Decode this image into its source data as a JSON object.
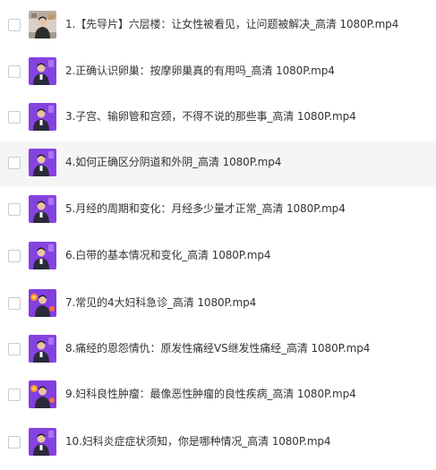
{
  "files": [
    {
      "name": "1.【先导片】六层楼：让女性被看见，让问题被解决_高清 1080P.mp4",
      "thumb": "room"
    },
    {
      "name": "2.正确认识卵巢：按摩卵巢真的有用吗_高清 1080P.mp4",
      "thumb": "purple"
    },
    {
      "name": "3.子宫、输卵管和宫颈，不得不说的那些事_高清 1080P.mp4",
      "thumb": "purple"
    },
    {
      "name": "4.如何正确区分阴道和外阴_高清 1080P.mp4",
      "thumb": "purple"
    },
    {
      "name": "5.月经的周期和变化：月经多少量才正常_高清 1080P.mp4",
      "thumb": "purple"
    },
    {
      "name": "6.白带的基本情况和变化_高清 1080P.mp4",
      "thumb": "purple"
    },
    {
      "name": "7.常见的4大妇科急诊_高清 1080P.mp4",
      "thumb": "emoji"
    },
    {
      "name": "8.痛经的恩怨情仇：原发性痛经VS继发性痛经_高清 1080P.mp4",
      "thumb": "purple"
    },
    {
      "name": "9.妇科良性肿瘤：最像恶性肿瘤的良性疾病_高清 1080P.mp4",
      "thumb": "emoji"
    },
    {
      "name": "10.妇科炎症症状须知，你是哪种情况_高清 1080P.mp4",
      "thumb": "purple"
    }
  ],
  "hovered_index": 3,
  "colors": {
    "row_hover": "#f5f5f6",
    "text": "#333333",
    "checkbox_border": "#c9ccd3",
    "thumb_purple": "#7b35d9",
    "thumb_room": "#d9cfc4"
  }
}
